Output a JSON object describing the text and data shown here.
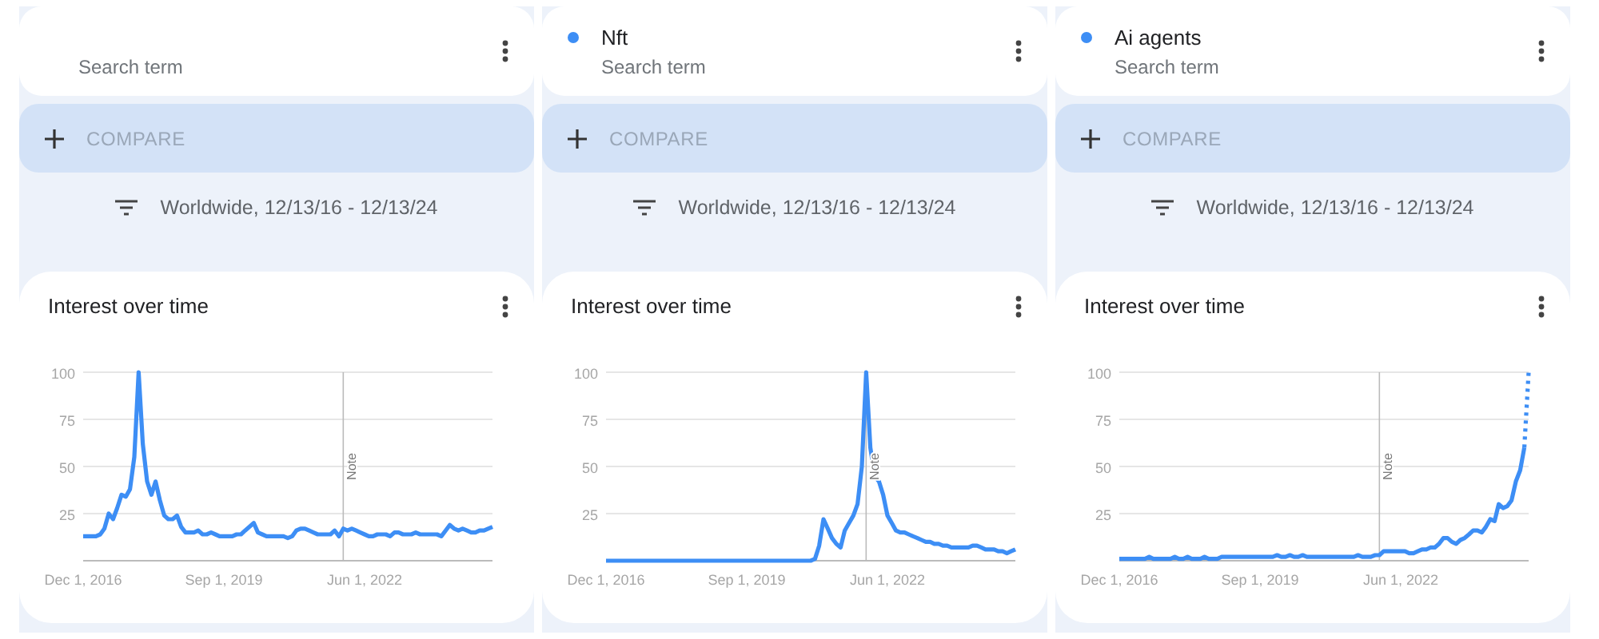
{
  "panels": [
    {
      "subtitle": "Search term",
      "compare": "COMPARE",
      "filter": "Worldwide, 12/13/16 - 12/13/24",
      "chart": {
        "title": "Interest over time",
        "chart_data": {
          "type": "line",
          "categories": [
            "Dec 1, 2016",
            null,
            null,
            null,
            null,
            null,
            null,
            null,
            null,
            null,
            null,
            null,
            null,
            null,
            null,
            null,
            null,
            null,
            null,
            null,
            null,
            null,
            null,
            null,
            null,
            null,
            null,
            null,
            null,
            null,
            null,
            null,
            null,
            "Sep 1, 2019",
            null,
            null,
            null,
            null,
            null,
            null,
            null,
            null,
            null,
            null,
            null,
            null,
            null,
            null,
            null,
            null,
            null,
            null,
            null,
            null,
            null,
            null,
            null,
            null,
            null,
            null,
            null,
            null,
            null,
            null,
            null,
            null,
            "Jun 1, 2022",
            null,
            null,
            null,
            null,
            null,
            null,
            null,
            null,
            null,
            null,
            null,
            null,
            null,
            null,
            null,
            null,
            null,
            null,
            null,
            null,
            null,
            null,
            null,
            null,
            null,
            null,
            null,
            null,
            null,
            null
          ],
          "ylim": [
            0,
            100
          ],
          "yticks": [
            25,
            50,
            75,
            100
          ],
          "grid": true,
          "annotations": [
            "Note"
          ],
          "series": [
            {
              "color": "#3d8ef5",
              "values": [
                13,
                13,
                13,
                13,
                14,
                17,
                25,
                22,
                28,
                35,
                34,
                38,
                55,
                100,
                62,
                42,
                35,
                42,
                32,
                24,
                22,
                22,
                24,
                18,
                15,
                15,
                15,
                16,
                14,
                14,
                15,
                14,
                13,
                13,
                13,
                13,
                14,
                14,
                16,
                18,
                20,
                15,
                14,
                13,
                13,
                13,
                13,
                13,
                12,
                13,
                16,
                17,
                17,
                16,
                15,
                14,
                14,
                14,
                14,
                16,
                13,
                17,
                16,
                17,
                16,
                15,
                14,
                13,
                13,
                14,
                14,
                14,
                13,
                15,
                15,
                14,
                14,
                14,
                15,
                14,
                14,
                14,
                14,
                14,
                13,
                16,
                19,
                17,
                16,
                17,
                16,
                15,
                15,
                16,
                16,
                17,
                18
              ]
            }
          ]
        }
      }
    },
    {
      "term": {
        "name": "Nft",
        "color": "#3d8ef5"
      },
      "subtitle": "Search term",
      "compare": "COMPARE",
      "filter": "Worldwide, 12/13/16 - 12/13/24",
      "chart": {
        "title": "Interest over time",
        "chart_data": {
          "type": "line",
          "categories": [
            "Dec 1, 2016",
            null,
            null,
            null,
            null,
            null,
            null,
            null,
            null,
            null,
            null,
            null,
            null,
            null,
            null,
            null,
            null,
            null,
            null,
            null,
            null,
            null,
            null,
            null,
            null,
            null,
            null,
            null,
            null,
            null,
            null,
            null,
            null,
            "Sep 1, 2019",
            null,
            null,
            null,
            null,
            null,
            null,
            null,
            null,
            null,
            null,
            null,
            null,
            null,
            null,
            null,
            null,
            null,
            null,
            null,
            null,
            null,
            null,
            null,
            null,
            null,
            null,
            null,
            null,
            null,
            null,
            null,
            null,
            "Jun 1, 2022",
            null,
            null,
            null,
            null,
            null,
            null,
            null,
            null,
            null,
            null,
            null,
            null,
            null,
            null,
            null,
            null,
            null,
            null,
            null,
            null,
            null,
            null,
            null,
            null,
            null,
            null,
            null,
            null,
            null,
            null
          ],
          "ylim": [
            0,
            100
          ],
          "yticks": [
            25,
            50,
            75,
            100
          ],
          "grid": true,
          "annotations": [
            "Note"
          ],
          "series": [
            {
              "color": "#3d8ef5",
              "values": [
                0,
                0,
                0,
                0,
                0,
                0,
                0,
                0,
                0,
                0,
                0,
                0,
                0,
                0,
                0,
                0,
                0,
                0,
                0,
                0,
                0,
                0,
                0,
                0,
                0,
                0,
                0,
                0,
                0,
                0,
                0,
                0,
                0,
                0,
                0,
                0,
                0,
                0,
                0,
                0,
                0,
                0,
                0,
                0,
                0,
                0,
                0,
                0,
                0,
                1,
                8,
                22,
                17,
                12,
                9,
                7,
                16,
                20,
                24,
                30,
                50,
                100,
                60,
                45,
                42,
                35,
                24,
                20,
                16,
                15,
                15,
                14,
                13,
                12,
                11,
                10,
                10,
                9,
                9,
                8,
                8,
                7,
                7,
                7,
                7,
                7,
                8,
                8,
                7,
                6,
                6,
                6,
                5,
                5,
                4,
                5,
                6
              ]
            }
          ]
        }
      }
    },
    {
      "term": {
        "name": "Ai agents",
        "color": "#3d8ef5"
      },
      "subtitle": "Search term",
      "compare": "COMPARE",
      "filter": "Worldwide, 12/13/16 - 12/13/24",
      "chart": {
        "title": "Interest over time",
        "chart_data": {
          "type": "line",
          "categories": [
            "Dec 1, 2016",
            null,
            null,
            null,
            null,
            null,
            null,
            null,
            null,
            null,
            null,
            null,
            null,
            null,
            null,
            null,
            null,
            null,
            null,
            null,
            null,
            null,
            null,
            null,
            null,
            null,
            null,
            null,
            null,
            null,
            null,
            null,
            null,
            "Sep 1, 2019",
            null,
            null,
            null,
            null,
            null,
            null,
            null,
            null,
            null,
            null,
            null,
            null,
            null,
            null,
            null,
            null,
            null,
            null,
            null,
            null,
            null,
            null,
            null,
            null,
            null,
            null,
            null,
            null,
            null,
            null,
            null,
            null,
            "Jun 1, 2022",
            null,
            null,
            null,
            null,
            null,
            null,
            null,
            null,
            null,
            null,
            null,
            null,
            null,
            null,
            null,
            null,
            null,
            null,
            null,
            null,
            null,
            null,
            null,
            null,
            null,
            null,
            null,
            null,
            null,
            null
          ],
          "ylim": [
            0,
            100
          ],
          "yticks": [
            25,
            50,
            75,
            100
          ],
          "grid": true,
          "annotations": [
            "Note"
          ],
          "series": [
            {
              "color": "#3d8ef5",
              "values": [
                1,
                1,
                1,
                1,
                1,
                1,
                1,
                2,
                1,
                1,
                1,
                1,
                1,
                2,
                1,
                1,
                2,
                1,
                1,
                1,
                2,
                1,
                1,
                1,
                2,
                2,
                2,
                2,
                2,
                2,
                2,
                2,
                2,
                2,
                2,
                2,
                2,
                3,
                2,
                2,
                3,
                2,
                2,
                3,
                2,
                2,
                2,
                2,
                2,
                2,
                2,
                2,
                2,
                2,
                2,
                2,
                3,
                2,
                2,
                2,
                3,
                3,
                5,
                5,
                5,
                5,
                5,
                5,
                4,
                4,
                5,
                6,
                6,
                7,
                7,
                9,
                12,
                12,
                10,
                9,
                11,
                12,
                14,
                16,
                16,
                15,
                18,
                22,
                21,
                30,
                28,
                29,
                32,
                42,
                48,
                60,
                null
              ]
            },
            {
              "color": "#3d8ef5",
              "line_style": "dotted",
              "values": [
                null,
                null,
                null,
                null,
                null,
                null,
                null,
                null,
                null,
                null,
                null,
                null,
                null,
                null,
                null,
                null,
                null,
                null,
                null,
                null,
                null,
                null,
                null,
                null,
                null,
                null,
                null,
                null,
                null,
                null,
                null,
                null,
                null,
                null,
                null,
                null,
                null,
                null,
                null,
                null,
                null,
                null,
                null,
                null,
                null,
                null,
                null,
                null,
                null,
                null,
                null,
                null,
                null,
                null,
                null,
                null,
                null,
                null,
                null,
                null,
                null,
                null,
                null,
                null,
                null,
                null,
                null,
                null,
                null,
                null,
                null,
                null,
                null,
                null,
                null,
                null,
                null,
                null,
                null,
                null,
                null,
                null,
                null,
                null,
                null,
                null,
                null,
                null,
                null,
                null,
                null,
                null,
                null,
                null,
                null,
                60,
                100
              ]
            }
          ]
        }
      }
    }
  ]
}
